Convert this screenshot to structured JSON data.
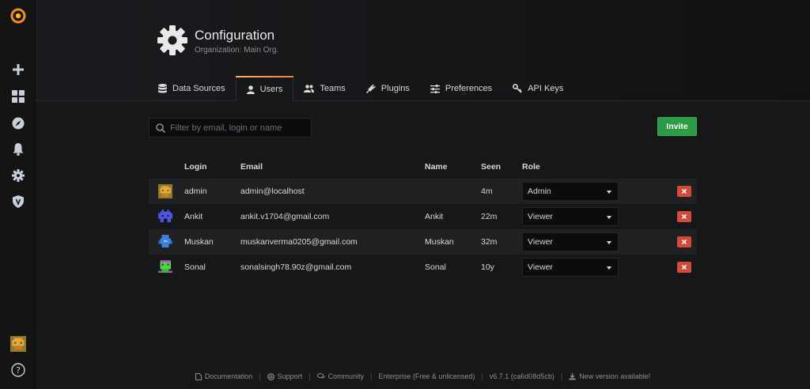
{
  "header": {
    "title": "Configuration",
    "subtitle": "Organization: Main Org."
  },
  "tabs": [
    {
      "label": "Data Sources",
      "icon": "database-icon",
      "active": false
    },
    {
      "label": "Users",
      "icon": "user-icon",
      "active": true
    },
    {
      "label": "Teams",
      "icon": "users-icon",
      "active": false
    },
    {
      "label": "Plugins",
      "icon": "plug-icon",
      "active": false
    },
    {
      "label": "Preferences",
      "icon": "sliders-icon",
      "active": false
    },
    {
      "label": "API Keys",
      "icon": "key-icon",
      "active": false
    }
  ],
  "search": {
    "placeholder": "Filter by email, login or name",
    "value": ""
  },
  "invite_label": "Invite",
  "table": {
    "headers": {
      "login": "Login",
      "email": "Email",
      "name": "Name",
      "seen": "Seen",
      "role": "Role"
    },
    "rows": [
      {
        "login": "admin",
        "email": "admin@localhost",
        "name": "",
        "seen": "4m",
        "role": "Admin",
        "avatar": "avatar-orange"
      },
      {
        "login": "Ankit",
        "email": "ankit.v1704@gmail.com",
        "name": "Ankit",
        "seen": "22m",
        "role": "Viewer",
        "avatar": "avatar-blue-invader"
      },
      {
        "login": "Muskan",
        "email": "muskanverma0205@gmail.com",
        "name": "Muskan",
        "seen": "32m",
        "role": "Viewer",
        "avatar": "avatar-blue"
      },
      {
        "login": "Sonal",
        "email": "sonalsingh78.90z@gmail.com",
        "name": "Sonal",
        "seen": "10y",
        "role": "Viewer",
        "avatar": "avatar-green"
      }
    ]
  },
  "footer": {
    "documentation": "Documentation",
    "support": "Support",
    "community": "Community",
    "edition": "Enterprise (Free & unlicensed)",
    "version": "v6.7.1 (ca6d08d5cb)",
    "update": "New version available!"
  },
  "colors": {
    "accent_orange": "#ff7941",
    "invite_green": "#299c46",
    "delete_red": "#d44a3a",
    "background": "#161719"
  }
}
